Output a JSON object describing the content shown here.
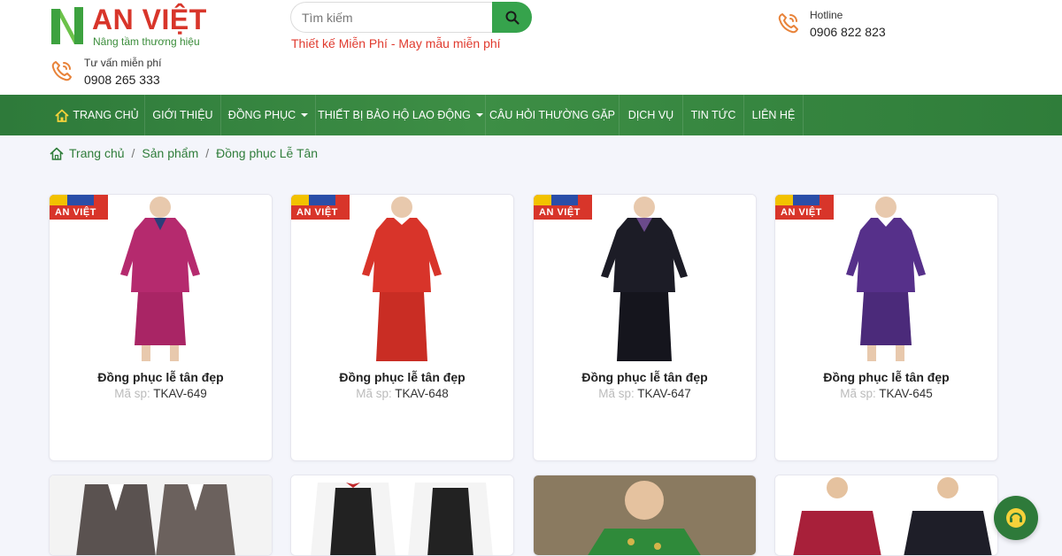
{
  "brand": {
    "name": "AN VIỆT",
    "tagline": "Nâng tầm thương hiệu",
    "badge_text": "AN VIỆT"
  },
  "consult": {
    "label": "Tư vấn miễn phí",
    "phone": "0908 265 333"
  },
  "search": {
    "placeholder": "Tìm kiếm"
  },
  "promo_text": "Thiết kế Miễn Phí - May mẫu miễn phí",
  "hotline": {
    "label": "Hotline",
    "phone": "0906 822 823"
  },
  "nav": {
    "items": [
      {
        "label": "TRANG CHỦ"
      },
      {
        "label": "GIỚI THIỆU"
      },
      {
        "label": "ĐỒNG PHỤC"
      },
      {
        "label": "THIẾT BỊ BẢO HỘ LAO ĐỘNG"
      },
      {
        "label": "CÂU HỎI THƯỜNG GẶP"
      },
      {
        "label": "DỊCH VỤ"
      },
      {
        "label": "TIN TỨC"
      },
      {
        "label": "LIÊN HỆ"
      }
    ]
  },
  "breadcrumb": {
    "home": "Trang chủ",
    "separator": "/",
    "products": "Sản phẩm",
    "current": "Đồng phục Lễ Tân"
  },
  "products": [
    {
      "name": "Đồng phục lễ tân đẹp",
      "code_label": "Mã sp:",
      "code": "TKAV-649",
      "color": "#b52a6e"
    },
    {
      "name": "Đồng phục lễ tân đẹp",
      "code_label": "Mã sp:",
      "code": "TKAV-648",
      "color": "#d8342a"
    },
    {
      "name": "Đồng phục lễ tân đẹp",
      "code_label": "Mã sp:",
      "code": "TKAV-647",
      "color": "#1c1c26"
    },
    {
      "name": "Đồng phục lễ tân đẹp",
      "code_label": "Mã sp:",
      "code": "TKAV-645",
      "color": "#56308a"
    }
  ],
  "colors": {
    "brand_red": "#d8352a",
    "brand_green": "#2e7a3a",
    "accent_orange": "#e8833a"
  }
}
